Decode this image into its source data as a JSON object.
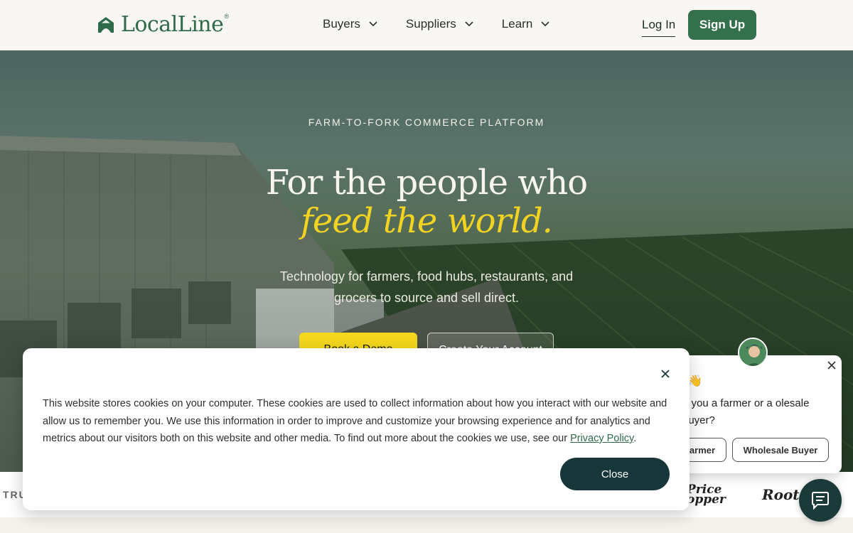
{
  "header": {
    "logo_text": "LocalLine",
    "logo_reg": "®",
    "nav": [
      {
        "label": "Buyers"
      },
      {
        "label": "Suppliers"
      },
      {
        "label": "Learn"
      }
    ],
    "login_label": "Log In",
    "signup_label": "Sign Up"
  },
  "hero": {
    "eyebrow": "FARM-TO-FORK COMMERCE PLATFORM",
    "headline_line1": "For the people who",
    "headline_line2": "feed the world.",
    "subtext": "Technology for farmers, food hubs, restaurants, and grocers to source and sell direct.",
    "primary_cta": "Book a Demo",
    "secondary_cta": "Create Your Account"
  },
  "logos_strip": {
    "trusted_label": "TRU",
    "brand_price_line1": "Price",
    "brand_price_line2": "opper",
    "brand_roots": "Roots"
  },
  "cookie_banner": {
    "text": "This website stores cookies on your computer. These cookies are used to collect information about how you interact with our website and allow us to remember you. We use this information in order to improve and customize your browsing experience and for analytics and metrics about our visitors both on this website and other media. To find out more about the cookies we use, see our ",
    "link_label": "Privacy Policy",
    "text_end": ".",
    "close_button": "Close"
  },
  "chat_widget": {
    "wave": "👋",
    "question": "e you a farmer or a olesale buyer?",
    "option_farmer": "armer",
    "option_buyer": "Wholesale Buyer"
  },
  "colors": {
    "brand_green": "#35704c",
    "accent_yellow": "#f4d81c",
    "dark_teal": "#17363a"
  },
  "icons": [
    "logo-house-icon",
    "chevron-down-icon",
    "close-icon",
    "chat-bubble-icon"
  ]
}
